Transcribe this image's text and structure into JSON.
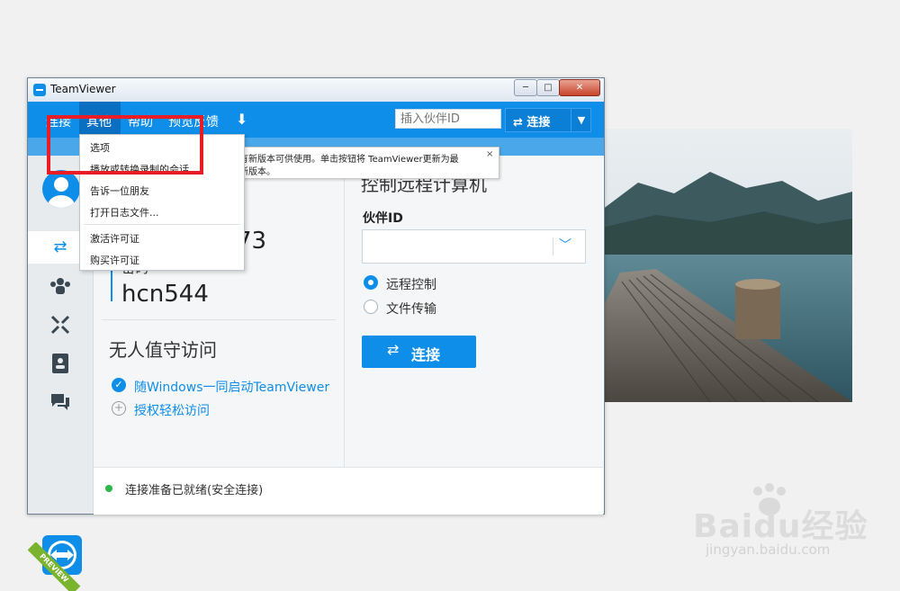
{
  "window": {
    "title": "TeamViewer"
  },
  "menubar": {
    "connect": "连接",
    "extras": "其他",
    "help": "帮助",
    "feedback": "预览反馈",
    "partner_id_placeholder": "插入伙伴ID",
    "connect_button": "连接"
  },
  "dropdown": {
    "items": [
      "选项",
      "播放或转换录制的会话...",
      "告诉一位朋友",
      "打开日志文件...",
      "激活许可证",
      "购买许可证"
    ]
  },
  "tooltip": {
    "line1": "有新版本可供使用。单击按钮将 TeamViewer更新为最",
    "line2": "新版本。",
    "close": "×"
  },
  "left_panel": {
    "your_id_partial": "73",
    "password_label": "密码",
    "password": "hcn544",
    "unattended_title": "无人值守访问",
    "start_with_windows": "随Windows一同启动TeamViewer",
    "easy_access": "授权轻松访问"
  },
  "right_panel": {
    "title": "控制远程计算机",
    "partner_id_label": "伙伴ID",
    "partner_id_value": "",
    "radio_remote": "远程控制",
    "radio_file": "文件传输",
    "selected_mode": "远程控制",
    "connect_button": "连接"
  },
  "status": {
    "text": "连接准备已就绪(安全连接)",
    "color": "#2db84b"
  },
  "sidebar": {
    "preview_badge": "PREVIEW",
    "icons": [
      "remote-control-icon",
      "meeting-icon",
      "computers-icon",
      "contacts-icon",
      "chat-icon"
    ]
  },
  "colors": {
    "accent": "#0e8ee9",
    "highlight": "#e81d25"
  },
  "watermark": {
    "brand": "Baidu经验",
    "url": "jingyan.baidu.com"
  }
}
